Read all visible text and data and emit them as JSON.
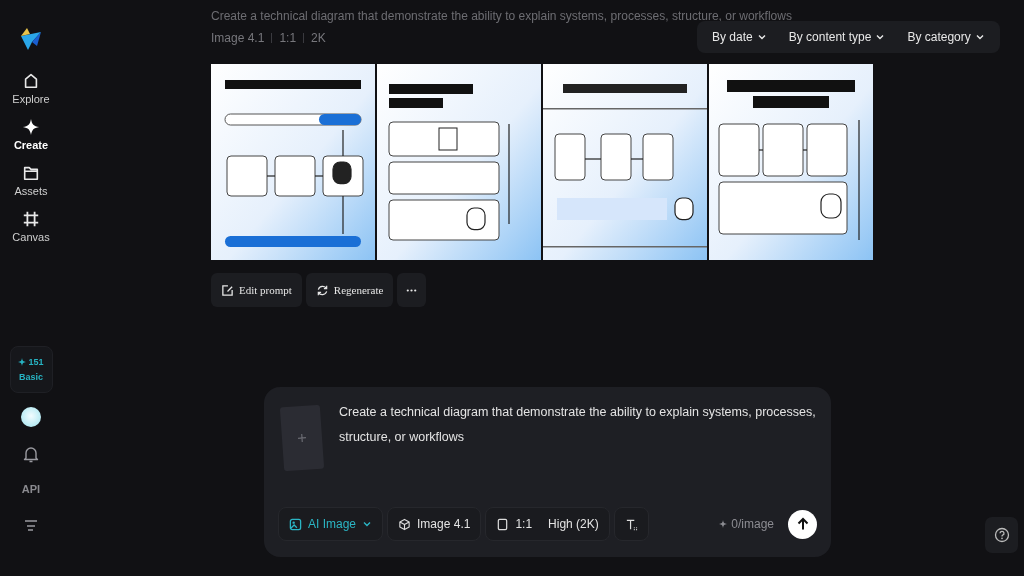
{
  "sidebar": {
    "items": [
      {
        "kind": "home",
        "label": "Explore",
        "selected": false
      },
      {
        "kind": "sparkle",
        "label": "Create",
        "selected": true
      },
      {
        "kind": "folder",
        "label": "Assets",
        "selected": false
      },
      {
        "kind": "grid",
        "label": "Canvas",
        "selected": false
      }
    ],
    "credits": {
      "count": "151",
      "plan": "Basic"
    },
    "api": "API"
  },
  "header": {
    "prompt": "Create a technical diagram that demonstrate the ability to explain systems, processes, structure, or workflows",
    "meta": [
      "Image 4.1",
      "1:1",
      "2K"
    ]
  },
  "filters": [
    "By date",
    "By content type",
    "By category"
  ],
  "results": {
    "actions": [
      {
        "kind": "edit",
        "label": "Edit prompt"
      },
      {
        "kind": "regenerate",
        "label": "Regenerate"
      },
      {
        "kind": "more"
      }
    ]
  },
  "composer": {
    "text": "Create a technical diagram that demonstrate the ability to explain systems, processes, structure, or workflows",
    "tools": [
      {
        "kind": "mode",
        "labels": [
          "AI Image"
        ]
      },
      {
        "kind": "model",
        "labels": [
          "Image 4.1"
        ]
      },
      {
        "kind": "size",
        "labels": [
          "1:1",
          "High (2K)"
        ]
      },
      {
        "kind": "text"
      }
    ],
    "cost": "0/image"
  }
}
